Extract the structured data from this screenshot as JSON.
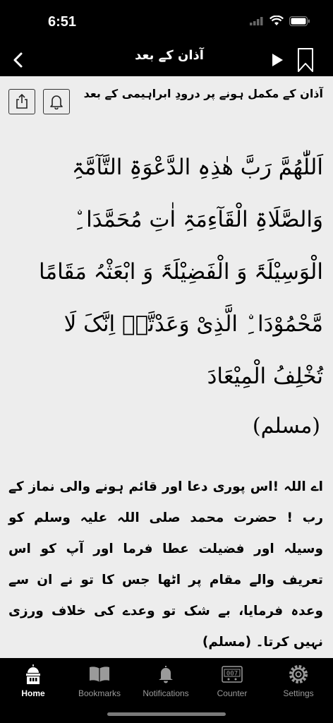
{
  "status_bar": {
    "time": "6:51"
  },
  "nav": {
    "title": "آذان کے بعد",
    "back_icon": "chevron-left-icon",
    "play_icon": "play-icon",
    "bookmark_icon": "bookmark-icon"
  },
  "dua": {
    "title": "آذان کے مکمل ہونے پر درودِ ابراہیمی کے بعد",
    "arabic": "اَللّٰھُمَّ رَبَّ ھٰذِہِ الدَّعْوَۃِ التَّآمَّۃِ وَالصَّلَاۃِ الْقَآءِمَۃِ اٰتِ مُحَمَّدَا ِۨ الْوَسِیْلَۃَ وَ الْفَضِیْلَۃَ وَ ابْعَثْہُ مَقَامًا مَّحْمُوْدَا ِۨ الَّذِیْ وَعَدْتَّہٗ اِنَّکَ لَا تُخْلِفُ الْمِیْعَادَ",
    "reference": "(مسلم)",
    "translation": "اے اللہ !اس پوری دعا اور قائم ہونے والی نماز کے رب ! حضرت محمد صلی اللہ علیہ وسلم کو وسیلہ اور فضیلت عطا فرما اور آپ کو اس تعریف والے مقام پر اٹھا جس کا تو نے ان سے وعدہ فرمایا، بے شک تو وعدے کی خلاف ورزی نہیں کرتا۔ (مسلم)"
  },
  "actions": {
    "share_icon": "share-icon",
    "notify_icon": "bell-icon"
  },
  "tabs": [
    {
      "label": "Home",
      "icon": "mosque-icon",
      "active": true
    },
    {
      "label": "Bookmarks",
      "icon": "book-icon",
      "active": false
    },
    {
      "label": "Notifications",
      "icon": "bell-icon",
      "active": false
    },
    {
      "label": "Counter",
      "icon": "counter-icon",
      "active": false
    },
    {
      "label": "Settings",
      "icon": "gear-icon",
      "active": false
    }
  ],
  "colors": {
    "background": "#000000",
    "content_bg": "#ededed",
    "active_tab": "#ffffff",
    "inactive_tab": "#9a9a9a"
  }
}
